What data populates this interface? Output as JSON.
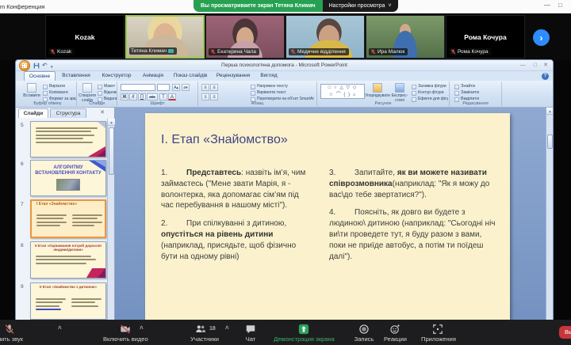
{
  "header": {
    "app_title": "Zoom Конференция",
    "banner": "Вы просматриваете экран Тетяна Климач",
    "view_settings": "Настройки просмотра",
    "chevron": "˅",
    "minimize": "—",
    "maximize": "□"
  },
  "participants": {
    "tiles": [
      {
        "label": "Kozak",
        "display": "Kozak"
      },
      {
        "label": "Тетяна Климач"
      },
      {
        "label": "Екатерина Чала"
      },
      {
        "label": "Медичне відділення"
      },
      {
        "label": "Ира Малюк"
      },
      {
        "label": "Рома Кочура",
        "display": "Рома Кочура"
      }
    ],
    "next": "›"
  },
  "ppt": {
    "window_title": "Перша психологічна допомога - Microsoft PowerPoint",
    "qat": {
      "undo": "↶",
      "dropdown": "▾"
    },
    "win": {
      "min": "—",
      "max": "□",
      "close": "✕"
    },
    "help": "?",
    "tabs": [
      "Основне",
      "Вставлення",
      "Конструктор",
      "Анімація",
      "Показ слайдів",
      "Рецензування",
      "Вигляд"
    ],
    "ribbon": {
      "clipboard": {
        "label": "Буфер обміну",
        "paste": "Вставити",
        "cut": "Вирізати",
        "copy": "Копіювати",
        "fmt": "Формат за зразком"
      },
      "slides": {
        "label": "Слайди",
        "new": "Створити слайд",
        "layout": "Макет",
        "reset": "Відновити",
        "del": "Видалити"
      },
      "font": {
        "label": "Шрифт",
        "grow": "А▴",
        "shrink": "а▾",
        "buttons": [
          "Ж",
          "К",
          "П",
          "абв",
          "Т",
          "А"
        ]
      },
      "paragraph": {
        "label": "Абзац",
        "dir": "Напрямок тексту",
        "align": "Вирівняти текст",
        "smartart": "Перетворити на об’єкт SmartArt",
        "g1": "≡",
        "g2": "≡",
        "g3": "≡",
        "g4": "≡"
      },
      "drawing": {
        "label": "Рисунок",
        "shapes1": "□ ○ △ ▽ ◇",
        "shapes2": "☆ ⌒ ( ) ⌂",
        "arrange": "Упорядкувати",
        "quick": "Експрес-стилі",
        "fill": "Заливка фігури",
        "outline": "Контур фігури",
        "effects": "Ефекти для фігур"
      },
      "editing": {
        "label": "Редагування",
        "find": "Знайти",
        "replace": "Замінити",
        "select": "Виділити"
      }
    },
    "panel": {
      "tab_slides": "Слайди",
      "tab_outline": "Структура",
      "close": "✕",
      "scroll_up": "▲",
      "thumbs": [
        {
          "num": "5"
        },
        {
          "num": "6",
          "title": "АЛГОРИТМУ ВСТАНОВЛЕННЯ КОНТАКТУ"
        },
        {
          "num": "7",
          "title": "І Етап «Знайомство»"
        },
        {
          "num": "8",
          "title": "ІІ Етап «Оцінювання потреб дорослої людини/дитини»"
        },
        {
          "num": "9",
          "title": "ІІ Етап «Знайомство з дитиною»"
        }
      ]
    },
    "slide": {
      "title": "І. Етап «Знайомство»",
      "items": [
        {
          "num": "1.",
          "pre": "",
          "bold": "Представтесь",
          "post": ": назвіть ім’я, чим займаєтесь (\"Мене звати Марія, я - волонтерка, яка допомагає сім’ям під час перебування в нашому місті\")."
        },
        {
          "num": "2.",
          "pre": "При спілкуванні з дитиною, ",
          "bold": "опустіться на рівень дитини",
          "post": " (наприклад, присядьте, щоб фізично бути на одному рівні)"
        },
        {
          "num": "3.",
          "pre": "Запитайте, ",
          "bold": "як ви можете називати співрозмовника",
          "post": "(наприклад: \"Як я можу до вас\\до тебе звертатися?\")."
        },
        {
          "num": "4.",
          "pre": "Поясніть, як довго ви будете з людиною\\ дитиною (наприклад: \"Сьогодні ніч ви\\ти проведете тут, я буду разом з вами, поки не приїде автобус, а потім ти поїдеш далі\").",
          "bold": "",
          "post": ""
        }
      ]
    },
    "scrollbar": {
      "up": "▲"
    }
  },
  "toolbar": {
    "audio": "Включить звук",
    "video": "Включить видео",
    "participants": "Участники",
    "participants_count": "18",
    "chat": "Чат",
    "share": "Демонстрация экрана",
    "record": "Запись",
    "reactions": "Реакции",
    "apps": "Приложения",
    "leave": "Выход",
    "chevron": "˄"
  },
  "colors": {
    "accent_green": "#26a152",
    "share_green": "#3cb368",
    "leave_red": "#c9353c",
    "active_speaker": "#98c849"
  }
}
